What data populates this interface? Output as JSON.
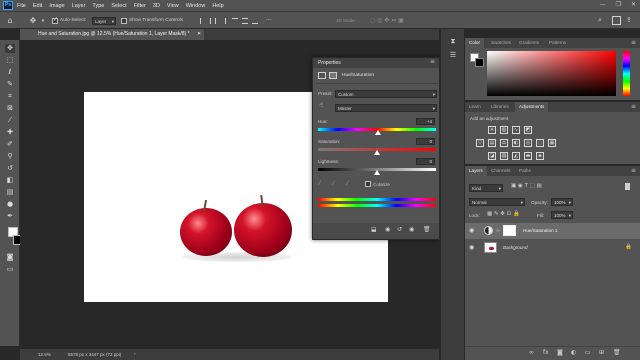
{
  "menubar": {
    "logo": "Ps",
    "items": [
      "File",
      "Edit",
      "Image",
      "Layer",
      "Type",
      "Select",
      "Filter",
      "3D",
      "View",
      "Window",
      "Help"
    ],
    "window_controls": [
      "—",
      "❐",
      "✕"
    ]
  },
  "options": {
    "auto_select_label": "Auto-Select:",
    "auto_select_target": "Layer",
    "show_transform_label": "Show Transform Controls",
    "mode_label": "3D Mode:"
  },
  "document": {
    "tab_title": "Hue and Saturation.jpg @ 12.5% (Hue/Saturation 1, Layer Mask/8) *",
    "zoom": "12.5%",
    "info": "5578 px x 3447 px (72 ppi)"
  },
  "properties": {
    "title": "Properties",
    "subtitle": "Hue/Saturation",
    "preset_label": "Preset:",
    "preset_value": "Custom",
    "channel_value": "Master",
    "hue_label": "Hue:",
    "hue_value": "+4",
    "saturation_label": "Saturation:",
    "saturation_value": "0",
    "lightness_label": "Lightness:",
    "lightness_value": "0",
    "colorize_label": "Colorize",
    "hue_level": 0.51,
    "saturation_level": 0.5,
    "lightness_level": 0.5
  },
  "color_panel": {
    "tabs": [
      "Color",
      "Swatches",
      "Gradients",
      "Patterns"
    ],
    "active_tab": "Color",
    "hue_color": "#ff0000"
  },
  "adjust_panel": {
    "tabs": [
      "Learn",
      "Libraries",
      "Adjustments"
    ],
    "active_tab": "Adjustments",
    "add_label": "Add an adjustment"
  },
  "layers_panel": {
    "tabs": [
      "Layers",
      "Channels",
      "Paths"
    ],
    "active_tab": "Layers",
    "kind_label": "Kind",
    "blend_mode": "Normal",
    "opacity_label": "Opacity:",
    "opacity_value": "100%",
    "lock_label": "Lock:",
    "fill_label": "Fill:",
    "fill_value": "100%",
    "layers": [
      {
        "name": "Hue/Saturation 1",
        "selected": true
      },
      {
        "name": "Background",
        "selected": false
      }
    ]
  },
  "icons": {
    "move": "move-icon",
    "home": "home-icon"
  }
}
